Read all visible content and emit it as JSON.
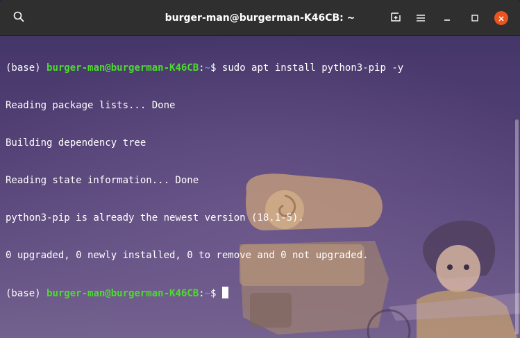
{
  "window": {
    "title": "burger-man@burgerman-K46CB: ~"
  },
  "titlebar_icons": {
    "search": "search-icon",
    "new_tab": "new-tab-icon",
    "menu": "hamburger-menu-icon",
    "minimize": "minimize-icon",
    "maximize": "maximize-icon",
    "close": "close-icon"
  },
  "terminal": {
    "prompt1": {
      "env": "(base) ",
      "user_host": "burger-man@burgerman-K46CB",
      "sep": ":",
      "path": "~",
      "symbol": "$ ",
      "command": "sudo apt install python3-pip -y"
    },
    "output": [
      "Reading package lists... Done",
      "Building dependency tree",
      "Reading state information... Done",
      "python3-pip is already the newest version (18.1-5).",
      "0 upgraded, 0 newly installed, 0 to remove and 0 not upgraded."
    ],
    "prompt2": {
      "env": "(base) ",
      "user_host": "burger-man@burgerman-K46CB",
      "sep": ":",
      "path": "~",
      "symbol": "$ "
    }
  },
  "colors": {
    "titlebar": "#2f2f2f",
    "close_button": "#e95420",
    "prompt_user": "#4ddb2e",
    "prompt_path": "#6a8fd8",
    "text": "#ffffff"
  }
}
